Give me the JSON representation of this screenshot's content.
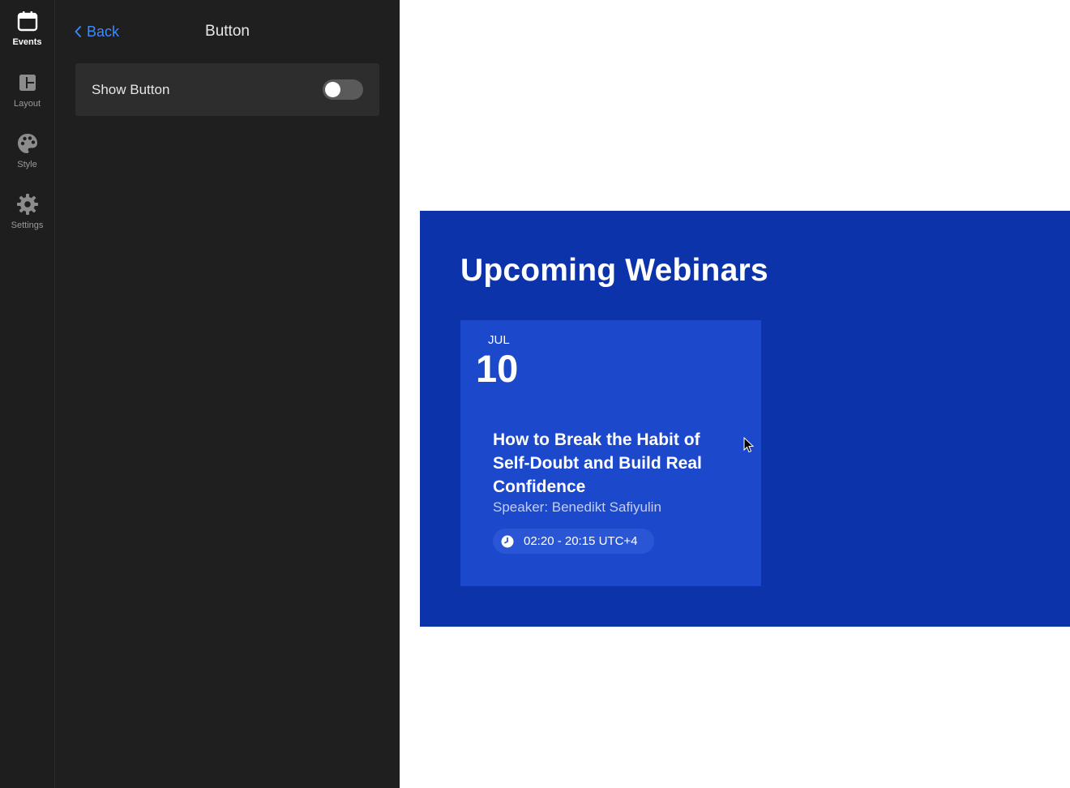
{
  "sidebar": {
    "items": [
      {
        "label": "Events",
        "icon": "calendar-icon",
        "active": true
      },
      {
        "label": "Layout",
        "icon": "layout-icon",
        "active": false
      },
      {
        "label": "Style",
        "icon": "palette-icon",
        "active": false
      },
      {
        "label": "Settings",
        "icon": "gear-icon",
        "active": false
      }
    ]
  },
  "panel": {
    "back_label": "Back",
    "title": "Button",
    "option": {
      "label": "Show Button",
      "enabled": false
    }
  },
  "preview": {
    "title": "Upcoming Webinars",
    "event": {
      "month": "JUL",
      "day": "10",
      "title": "How to Break the Habit of Self-Doubt and Build Real Confidence",
      "speaker": "Speaker: Benedikt Safiyulin",
      "time": "02:20 - 20:15 UTC+4"
    }
  },
  "colors": {
    "rail_bg": "#1e1e1e",
    "panel_bg": "#1f1f1f",
    "accent_link": "#3d8bfd",
    "widget_bg": "#0d33aa",
    "card_bg": "#1c48cc"
  }
}
